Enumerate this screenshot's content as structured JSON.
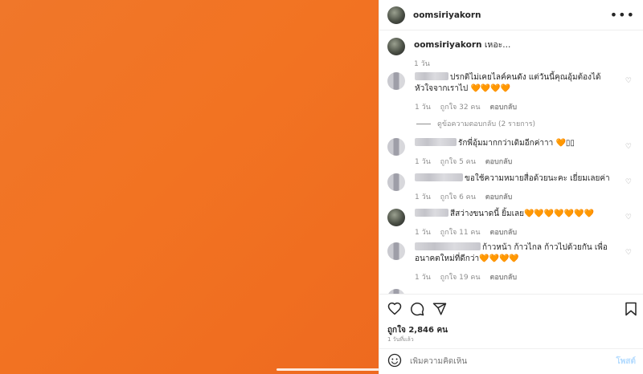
{
  "post": {
    "username": "oomsiriyakorn",
    "more_icon": "more-horizontal-icon",
    "caption": {
      "username": "oomsiriyakorn",
      "text": "เหอะ...",
      "time": "1 วัน"
    }
  },
  "comments": [
    {
      "text": "ปรกติไม่เคยไลค์คนดัง แต่วันนี้คุณอุ้มต้องได้หัวใจจากเราไป 🧡🧡🧡🧡",
      "time": "1 วัน",
      "likes": "ถูกใจ 32 คน",
      "reply": "ตอบกลับ",
      "view_replies": "ดูข้อความตอบกลับ (2 รายการ)"
    },
    {
      "text": "รักพี่อุ้มมากกว่าเดิมอีกค่าาา 🧡▯▯",
      "time": "1 วัน",
      "likes": "ถูกใจ 5 คน",
      "reply": "ตอบกลับ"
    },
    {
      "text": "ขอใช้ความหมายสื่อด้วยนะคะ เยี่ยมเลยค่า",
      "time": "1 วัน",
      "likes": "ถูกใจ 6 คน",
      "reply": "ตอบกลับ"
    },
    {
      "text": "สีสว่างขนาดนี้ ยิ้มเลย🧡🧡🧡🧡🧡🧡🧡",
      "time": "1 วัน",
      "likes": "ถูกใจ 11 คน",
      "reply": "ตอบกลับ"
    },
    {
      "text": "ก้าวหน้า ก้าวไกล ก้าวไปด้วยกัน เพื่ออนาคตใหม่ที่ดีกว่า🧡🧡🧡🧡",
      "time": "1 วัน",
      "likes": "ถูกใจ 19 คน",
      "reply": "ตอบกลับ"
    }
  ],
  "actions": {
    "likes": "ถูกใจ 2,846 คน",
    "time": "1 วันที่แล้ว"
  },
  "composer": {
    "placeholder": "เพิ่มความคิดเห็น",
    "post_label": "โพสต์"
  },
  "colors": {
    "media_orange": "#f27322",
    "heart_orange": "#e8641c",
    "muted_text": "#8e8e8e",
    "post_button": "#b3dbff"
  }
}
